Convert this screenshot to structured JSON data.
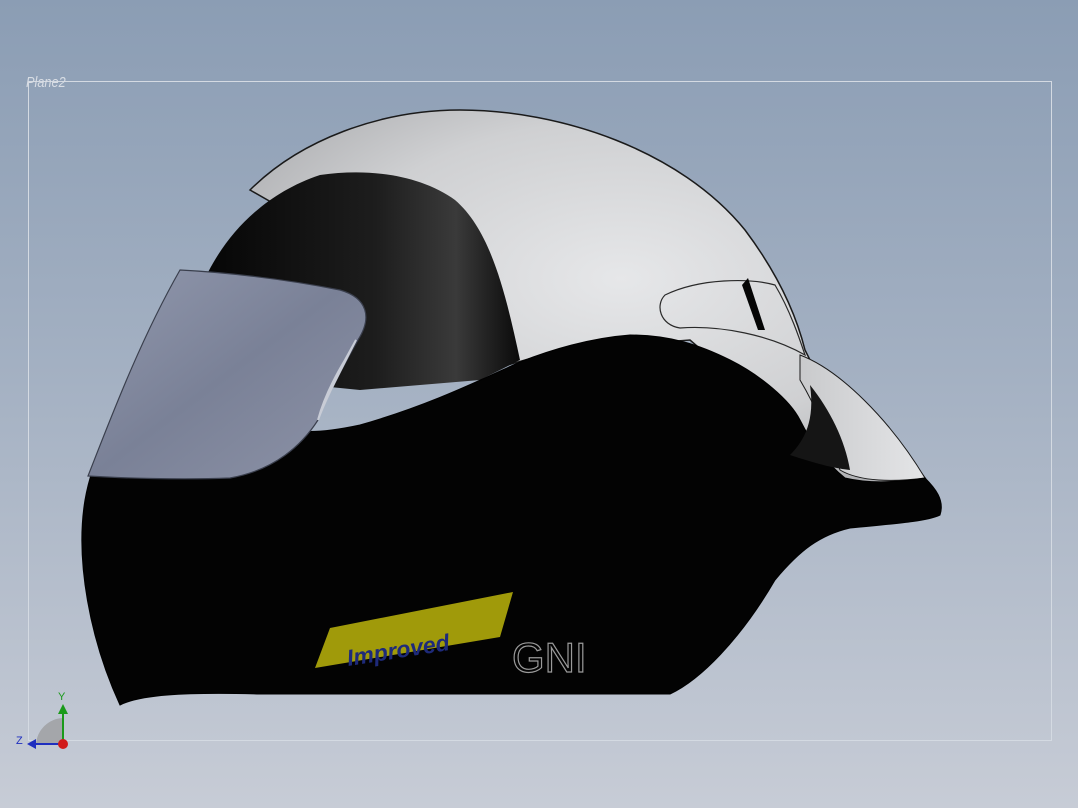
{
  "viewport": {
    "plane_label": "Plane2",
    "background_top": "#8b9db4",
    "background_bottom": "#c7ccd6"
  },
  "model": {
    "decal_text": "Improved",
    "decal_color": "#a09a0a",
    "decal_text_color": "#1e2a7a",
    "brand_text": "GNI",
    "shell_color": "#050505",
    "panel_color": "#d2d3d5",
    "visor_color": "#7c8399"
  },
  "triad": {
    "y_label": "Y",
    "z_label": "Z",
    "y_color": "#1a9a1a",
    "z_color": "#1f2fbf",
    "x_color": "#d11a1a"
  }
}
